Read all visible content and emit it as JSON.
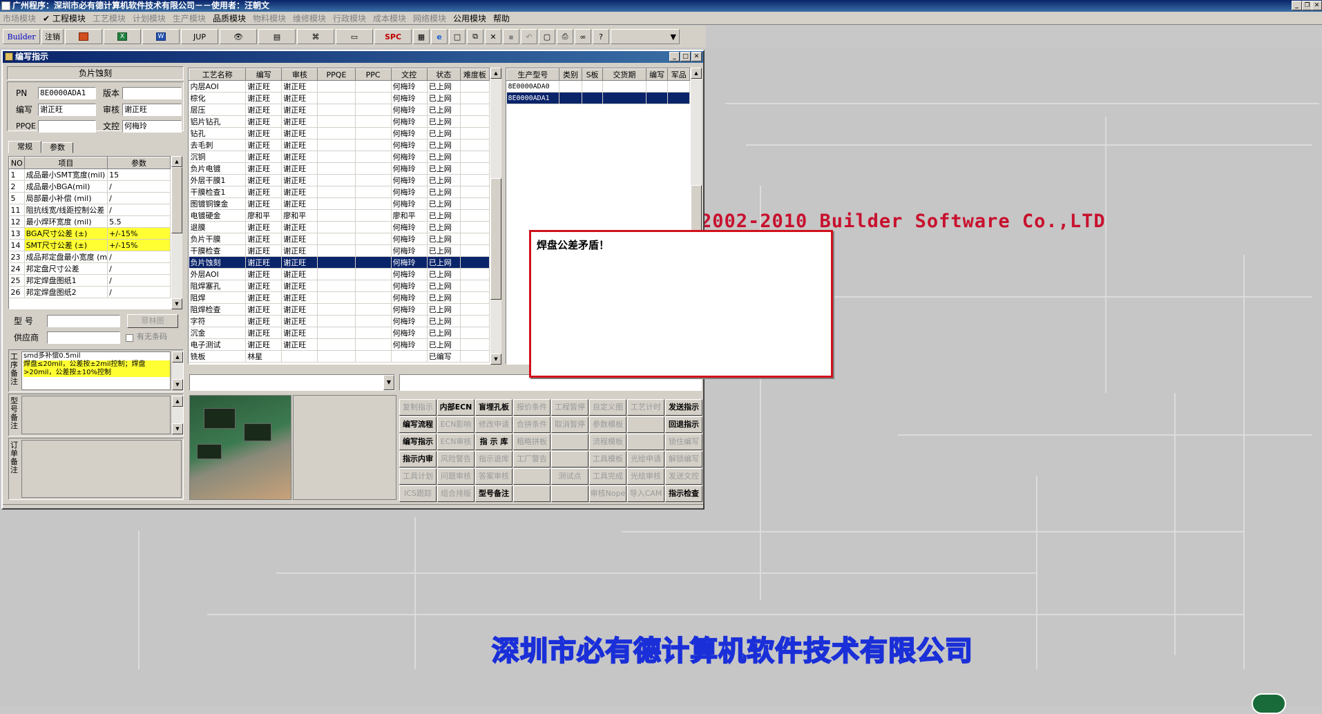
{
  "app": {
    "title": "广州程序：深圳市必有德计算机软件技术有限公司－－使用者：汪朝文"
  },
  "menu": [
    {
      "label": "市场模块",
      "enabled": false
    },
    {
      "label": "✔ 工程模块",
      "enabled": true
    },
    {
      "label": "工艺模块",
      "enabled": false
    },
    {
      "label": "计划模块",
      "enabled": false
    },
    {
      "label": "生产模块",
      "enabled": false
    },
    {
      "label": "品质模块",
      "enabled": true
    },
    {
      "label": "物料模块",
      "enabled": false
    },
    {
      "label": "维修模块",
      "enabled": false
    },
    {
      "label": "行政模块",
      "enabled": false
    },
    {
      "label": "成本模块",
      "enabled": false
    },
    {
      "label": "网络模块",
      "enabled": false
    },
    {
      "label": "公用模块",
      "enabled": true
    },
    {
      "label": "帮助",
      "enabled": true
    }
  ],
  "toolbar": {
    "builder": "Builder",
    "logout": "注销",
    "jup": "JUP",
    "spc": "SPC"
  },
  "wallpaper": {
    "copyright": "2002-2010 Builder Software Co.,LTD",
    "company": "深圳市必有德计算机软件技术有限公司"
  },
  "window": {
    "title": "编写指示"
  },
  "left": {
    "section_title": "负片蚀刻",
    "pn_label": "PN",
    "pn_value": "8E0000ADA1",
    "version_label": "版本",
    "version_value": "",
    "author_label": "编写",
    "author_value": "谢正旺",
    "review_label": "审核",
    "review_value": "谢正旺",
    "ppqe_label": "PPQE",
    "ppqe_value": "",
    "doc_label": "文控",
    "doc_value": "何梅玲",
    "tab_general": "常规",
    "tab_params": "参数",
    "param_headers": [
      "NO",
      "项目",
      "参数"
    ],
    "params": [
      {
        "no": "1",
        "item": "成品最小SMT宽度(mil)",
        "value": "15",
        "hl": false
      },
      {
        "no": "2",
        "item": "成品最小BGA(mil)",
        "value": "/",
        "hl": false
      },
      {
        "no": "5",
        "item": "局部最小补偿 (mil)",
        "value": "/",
        "hl": false
      },
      {
        "no": "11",
        "item": "阻抗线宽/线距控制公差",
        "value": "/",
        "hl": false
      },
      {
        "no": "12",
        "item": "最小焊环宽度 (mil)",
        "value": "5.5",
        "hl": false
      },
      {
        "no": "13",
        "item": "BGA尺寸公差 (±)",
        "value": "+/-15%",
        "hl": true
      },
      {
        "no": "14",
        "item": "SMT尺寸公差 (±)",
        "value": "+/-15%",
        "hl": true
      },
      {
        "no": "23",
        "item": "成品邦定盘最小宽度 (m",
        "value": "/",
        "hl": false
      },
      {
        "no": "24",
        "item": "邦定盘尺寸公差",
        "value": "/",
        "hl": false
      },
      {
        "no": "25",
        "item": "邦定焊盘图纸1",
        "value": "/",
        "hl": false
      },
      {
        "no": "26",
        "item": "邦定焊盘图纸2",
        "value": "/",
        "hl": false
      }
    ],
    "model_label": "型 号",
    "model_value": "",
    "film_button": "菲林图",
    "supplier_label": "供应商",
    "supplier_value": "",
    "nobar_label": "有无条码",
    "process_note_label": "工序备注",
    "process_note_lines": [
      "smd多补偿0.5mil",
      "焊盘≤20mil，公差按±2mil控制；焊盘",
      ">20mil，公差按±10%控制"
    ],
    "model_note_label": "型号备注",
    "order_note_label": "订单备注"
  },
  "process_grid": {
    "headers": [
      "工艺名称",
      "编写",
      "审核",
      "PPQE",
      "PPC",
      "文控",
      "状态",
      "难度板"
    ],
    "rows": [
      [
        "内层AOI",
        "谢正旺",
        "谢正旺",
        "",
        "",
        "何梅玲",
        "已上网",
        ""
      ],
      [
        "棕化",
        "谢正旺",
        "谢正旺",
        "",
        "",
        "何梅玲",
        "已上网",
        ""
      ],
      [
        "层压",
        "谢正旺",
        "谢正旺",
        "",
        "",
        "何梅玲",
        "已上网",
        ""
      ],
      [
        "铝片钻孔",
        "谢正旺",
        "谢正旺",
        "",
        "",
        "何梅玲",
        "已上网",
        ""
      ],
      [
        "钻孔",
        "谢正旺",
        "谢正旺",
        "",
        "",
        "何梅玲",
        "已上网",
        ""
      ],
      [
        "去毛刺",
        "谢正旺",
        "谢正旺",
        "",
        "",
        "何梅玲",
        "已上网",
        ""
      ],
      [
        "沉铜",
        "谢正旺",
        "谢正旺",
        "",
        "",
        "何梅玲",
        "已上网",
        ""
      ],
      [
        "负片电镀",
        "谢正旺",
        "谢正旺",
        "",
        "",
        "何梅玲",
        "已上网",
        ""
      ],
      [
        "外层干膜1",
        "谢正旺",
        "谢正旺",
        "",
        "",
        "何梅玲",
        "已上网",
        ""
      ],
      [
        "干膜检查1",
        "谢正旺",
        "谢正旺",
        "",
        "",
        "何梅玲",
        "已上网",
        ""
      ],
      [
        "图镀铜镍金",
        "谢正旺",
        "谢正旺",
        "",
        "",
        "何梅玲",
        "已上网",
        ""
      ],
      [
        "电镀硬金",
        "廖和平",
        "廖和平",
        "",
        "",
        "廖和平",
        "已上网",
        ""
      ],
      [
        "退膜",
        "谢正旺",
        "谢正旺",
        "",
        "",
        "何梅玲",
        "已上网",
        ""
      ],
      [
        "负片干膜",
        "谢正旺",
        "谢正旺",
        "",
        "",
        "何梅玲",
        "已上网",
        ""
      ],
      [
        "干膜检查",
        "谢正旺",
        "谢正旺",
        "",
        "",
        "何梅玲",
        "已上网",
        ""
      ],
      [
        "负片蚀刻",
        "谢正旺",
        "谢正旺",
        "",
        "",
        "何梅玲",
        "已上网",
        ""
      ],
      [
        "外层AOI",
        "谢正旺",
        "谢正旺",
        "",
        "",
        "何梅玲",
        "已上网",
        ""
      ],
      [
        "阻焊塞孔",
        "谢正旺",
        "谢正旺",
        "",
        "",
        "何梅玲",
        "已上网",
        ""
      ],
      [
        "阻焊",
        "谢正旺",
        "谢正旺",
        "",
        "",
        "何梅玲",
        "已上网",
        ""
      ],
      [
        "阻焊检查",
        "谢正旺",
        "谢正旺",
        "",
        "",
        "何梅玲",
        "已上网",
        ""
      ],
      [
        "字符",
        "谢正旺",
        "谢正旺",
        "",
        "",
        "何梅玲",
        "已上网",
        ""
      ],
      [
        "沉金",
        "谢正旺",
        "谢正旺",
        "",
        "",
        "何梅玲",
        "已上网",
        ""
      ],
      [
        "电子测试",
        "谢正旺",
        "谢正旺",
        "",
        "",
        "何梅玲",
        "已上网",
        ""
      ],
      [
        "铣板",
        "林星",
        "",
        "",
        "",
        "",
        "已编写",
        ""
      ]
    ],
    "selected_index": 15
  },
  "product_grid": {
    "headers": [
      "生产型号",
      "类别",
      "S板",
      "交货期",
      "编写",
      "军品"
    ],
    "rows": [
      [
        "8E0000ADA0",
        "",
        "",
        "",
        "",
        ""
      ],
      [
        "8E0000ADA1",
        "",
        "",
        "",
        "",
        ""
      ]
    ],
    "selected_index": 1
  },
  "buttons": [
    {
      "label": "复制指示",
      "enabled": false,
      "bold": false
    },
    {
      "label": "内部ECN",
      "enabled": true,
      "bold": true
    },
    {
      "label": "盲埋孔板",
      "enabled": true,
      "bold": true
    },
    {
      "label": "报价条件",
      "enabled": false,
      "bold": false
    },
    {
      "label": "工程暂停",
      "enabled": false,
      "bold": false
    },
    {
      "label": "自定义图",
      "enabled": false,
      "bold": false
    },
    {
      "label": "工艺计时",
      "enabled": false,
      "bold": false
    },
    {
      "label": "发送指示",
      "enabled": true,
      "bold": true
    },
    {
      "label": "编写流程",
      "enabled": true,
      "bold": true
    },
    {
      "label": "ECN影响",
      "enabled": false,
      "bold": false
    },
    {
      "label": "修改申请",
      "enabled": false,
      "bold": false
    },
    {
      "label": "合拼条件",
      "enabled": false,
      "bold": false
    },
    {
      "label": "取消暂停",
      "enabled": false,
      "bold": false
    },
    {
      "label": "参数模板",
      "enabled": false,
      "bold": false
    },
    {
      "label": "",
      "enabled": false,
      "bold": false
    },
    {
      "label": "回退指示",
      "enabled": true,
      "bold": true
    },
    {
      "label": "编写指示",
      "enabled": true,
      "bold": true
    },
    {
      "label": "ECN审核",
      "enabled": false,
      "bold": false
    },
    {
      "label": "指 示 库",
      "enabled": true,
      "bold": true
    },
    {
      "label": "粗略拼板",
      "enabled": false,
      "bold": false
    },
    {
      "label": "",
      "enabled": false,
      "bold": false
    },
    {
      "label": "流程模板",
      "enabled": false,
      "bold": false
    },
    {
      "label": "",
      "enabled": false,
      "bold": false
    },
    {
      "label": "锁住编写",
      "enabled": false,
      "bold": false
    },
    {
      "label": "指示内审",
      "enabled": true,
      "bold": true
    },
    {
      "label": "风险警告",
      "enabled": false,
      "bold": false
    },
    {
      "label": "指示退库",
      "enabled": false,
      "bold": false
    },
    {
      "label": "工厂警告",
      "enabled": false,
      "bold": false
    },
    {
      "label": "",
      "enabled": false,
      "bold": false
    },
    {
      "label": "工具模板",
      "enabled": false,
      "bold": false
    },
    {
      "label": "光绘申请",
      "enabled": false,
      "bold": false
    },
    {
      "label": "解锁编写",
      "enabled": false,
      "bold": false
    },
    {
      "label": "工具计划",
      "enabled": false,
      "bold": false
    },
    {
      "label": "问题审核",
      "enabled": false,
      "bold": false
    },
    {
      "label": "答案审核",
      "enabled": false,
      "bold": false
    },
    {
      "label": "",
      "enabled": false,
      "bold": false
    },
    {
      "label": "测试点",
      "enabled": false,
      "bold": false
    },
    {
      "label": "工具完成",
      "enabled": false,
      "bold": false
    },
    {
      "label": "光绘审核",
      "enabled": false,
      "bold": false
    },
    {
      "label": "发送文控",
      "enabled": false,
      "bold": false
    },
    {
      "label": "ICS跟踪",
      "enabled": false,
      "bold": false
    },
    {
      "label": "组合排版",
      "enabled": false,
      "bold": false
    },
    {
      "label": "型号备注",
      "enabled": true,
      "bold": true
    },
    {
      "label": "",
      "enabled": false,
      "bold": false
    },
    {
      "label": "",
      "enabled": false,
      "bold": false
    },
    {
      "label": "审核Nope",
      "enabled": false,
      "bold": false
    },
    {
      "label": "导入CAM",
      "enabled": false,
      "bold": false
    },
    {
      "label": "指示检查",
      "enabled": true,
      "bold": true
    }
  ],
  "dialog": {
    "message": "焊盘公差矛盾！"
  }
}
